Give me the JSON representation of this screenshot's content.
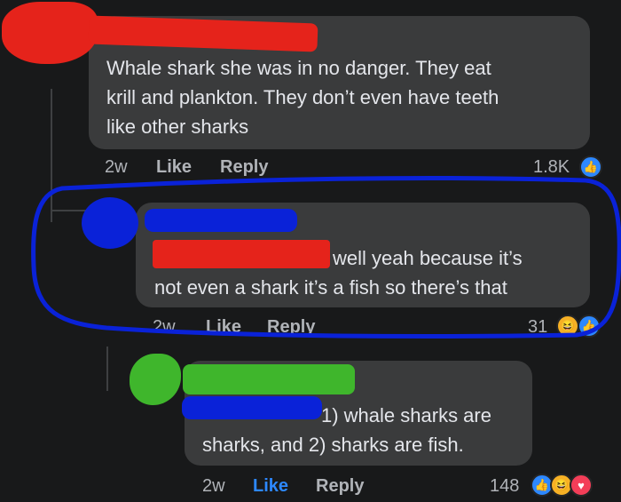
{
  "comments": [
    {
      "text_lines": [
        "Whale shark she was in no danger. They eat",
        "krill and plankton. They don’t even have teeth",
        "like other sharks"
      ],
      "time": "2w",
      "like_label": "Like",
      "reply_label": "Reply",
      "reaction_count": "1.8K",
      "reactions": [
        "like-icon"
      ]
    },
    {
      "text_lines": [
        "well yeah because it’s",
        "not even a shark it’s a fish so there’s that"
      ],
      "time": "2w",
      "like_label": "Like",
      "reply_label": "Reply",
      "reaction_count": "31",
      "reactions": [
        "haha-icon",
        "like-icon"
      ]
    },
    {
      "text_lines": [
        "1) whale sharks are",
        "sharks, and 2) sharks are fish."
      ],
      "time": "2w",
      "like_label": "Like",
      "reply_label": "Reply",
      "reaction_count": "148",
      "reactions": [
        "like-icon",
        "haha-icon",
        "love-icon"
      ]
    }
  ],
  "colors": {
    "background": "#18191a",
    "bubble": "#3a3b3c",
    "liked_blue": "#2d88ff",
    "scribble_red": "#e5231b",
    "scribble_blue": "#0a22d8",
    "scribble_green": "#3fb62c"
  }
}
